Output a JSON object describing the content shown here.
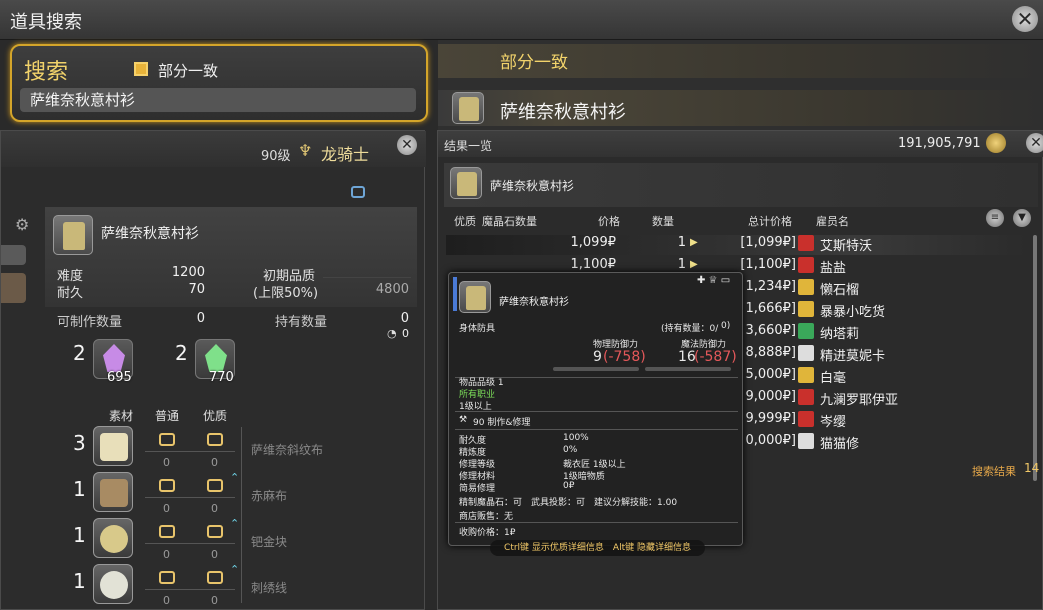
{
  "window": {
    "title": "道具搜索"
  },
  "search": {
    "label": "搜索",
    "partial_match_label": "部分一致",
    "partial_match_checked": true,
    "query": "萨维奈秋意村衫"
  },
  "right_header": {
    "mode_label": "部分一致",
    "item_name": "萨维奈秋意村衫"
  },
  "crafting": {
    "level": "90级",
    "job": "龙骑士",
    "recipe_name": "萨维奈秋意村衫",
    "difficulty_label": "难度",
    "difficulty": "1200",
    "durability_label": "耐久",
    "durability": "70",
    "initial_quality_label": "初期品质",
    "quality_cap_label": "(上限50%)",
    "quality_cap": "4800",
    "craftable_label": "可制作数量",
    "craftable": "0",
    "owned_label": "持有数量",
    "owned": "0",
    "owned_hq": "0",
    "crystals": [
      {
        "count": "2",
        "stock": "695",
        "color": "#c78be6"
      },
      {
        "count": "2",
        "stock": "770",
        "color": "#7fe08a"
      }
    ],
    "mat_headers": {
      "material": "素材",
      "nq": "普通",
      "hq": "优质"
    },
    "materials": [
      {
        "count": "3",
        "name": "萨维奈斜纹布",
        "nq": "0",
        "hq": "0",
        "color": "#e8dfba"
      },
      {
        "count": "1",
        "name": "赤麻布",
        "nq": "0",
        "hq": "0",
        "color": "#a88b63"
      },
      {
        "count": "1",
        "name": "钯金块",
        "nq": "0",
        "hq": "0",
        "color": "#d8c98a"
      },
      {
        "count": "1",
        "name": "刺绣线",
        "nq": "0",
        "hq": "0",
        "color": "#e2e2d6"
      }
    ]
  },
  "results": {
    "title": "结果一览",
    "gil": "191,905,791",
    "item_name": "萨维奈秋意村衫",
    "columns": {
      "quality": "优质",
      "materia": "魔晶石数量",
      "price": "价格",
      "qty": "数量",
      "total": "总计价格",
      "retainer": "雇员名"
    },
    "rows": [
      {
        "price": "1,099₽",
        "qty": "1",
        "total": "[1,099₽]",
        "retainer": "艾斯特沃",
        "color": "#c9302c"
      },
      {
        "price": "1,100₽",
        "qty": "1",
        "total": "[1,100₽]",
        "retainer": "盐盐",
        "color": "#c9302c"
      },
      {
        "price": "",
        "qty": "",
        "total": "1,234₽]",
        "retainer": "懒石榴",
        "color": "#e0b53a"
      },
      {
        "price": "",
        "qty": "",
        "total": "1,666₽]",
        "retainer": "暴暴小吃货",
        "color": "#e0b53a"
      },
      {
        "price": "",
        "qty": "",
        "total": "3,660₽]",
        "retainer": "纳塔莉",
        "color": "#3aa85a"
      },
      {
        "price": "",
        "qty": "",
        "total": "8,888₽]",
        "retainer": "精进莫妮卡",
        "color": "#dddddd"
      },
      {
        "price": "",
        "qty": "",
        "total": "5,000₽]",
        "retainer": "白毫",
        "color": "#e0b53a"
      },
      {
        "price": "",
        "qty": "",
        "total": "9,000₽]",
        "retainer": "九澜罗耶伊亚",
        "color": "#c9302c"
      },
      {
        "price": "",
        "qty": "",
        "total": "9,999₽]",
        "retainer": "岑缨",
        "color": "#c9302c"
      },
      {
        "price": "",
        "qty": "",
        "total": "0,000₽]",
        "retainer": "猫猫修",
        "color": "#dddddd"
      }
    ],
    "count_label": "搜索结果",
    "count": "14"
  },
  "tooltip": {
    "name": "萨维奈秋意村衫",
    "category": "身体防具",
    "owned": "(持有数量：0/",
    "owned_hq": "0)",
    "phys_label": "物理防御力",
    "phys": "9",
    "phys_diff": "(-758)",
    "mag_label": "魔法防御力",
    "mag": "16",
    "mag_diff": "(-587)",
    "item_level": "物品品级 1",
    "classes": "所有职业",
    "level": "1级以上",
    "craft_info": "90 制作&修理",
    "stats": [
      {
        "label": "耐久度",
        "value": "100%"
      },
      {
        "label": "精炼度",
        "value": "0%"
      },
      {
        "label": "修理等级",
        "value": "裁衣匠 1级以上"
      },
      {
        "label": "修理材料",
        "value": "1级暗物质"
      },
      {
        "label": "简易修理",
        "value": "0₽"
      }
    ],
    "line_materia": "精制魔晶石：可　武具投影：可　建议分解技能：1.00",
    "line_shop": "商店贩售：无",
    "line_sell": "收购价格：1₽",
    "hint": "Ctrl键 显示优质详细信息　Alt键 隐藏详细信息"
  }
}
